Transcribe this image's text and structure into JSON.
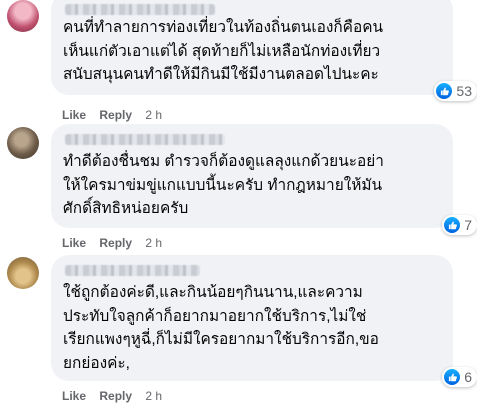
{
  "comments": [
    {
      "text": "คนที่ทำลายการท่องเที่ยวในท้องถิ่นตนเองก็คือคน\nเห็นแก่ตัวเอาแต่ได้ สุดท้ายก็ไม่เหลือนักท่องเที่ยว\nสนับสนุนคนทำดีให้มีกินมีใช้มีงานตลอดไปนะคะ",
      "reaction_count": "53",
      "like_label": "Like",
      "reply_label": "Reply",
      "time": "2 h"
    },
    {
      "text": "ทำดีต้องชื่นชม ตำรวจก็ต้องดูแลลุงแกด้วยนะอย่า\nให้ใครมาข่มขู่แกแบบนี้นะครับ ทำกฎหมายให้มัน\nศักดิ์สิทธิหน่อยครับ",
      "reaction_count": "7",
      "like_label": "Like",
      "reply_label": "Reply",
      "time": "2 h"
    },
    {
      "text": "ใช้ถูกต้องค่ะดี,และกินน้อยๆกินนาน,และความ\nประทับใจลูกค้าก็อยากมาอยากใช้บริการ,ไม่ใช่\nเรียกแพงๆหูฉี่,ก็ไม่มีใครอยากมาใช้บริการอีก,ขอ\nยกย่องค่ะ,",
      "reaction_count": "6",
      "like_label": "Like",
      "reply_label": "Reply",
      "time": "2 h"
    }
  ],
  "colors": {
    "bubble": "#f0f2f5",
    "text": "#050505",
    "secondary": "#65676b",
    "like_blue": "#1877f2"
  },
  "icons": [
    "like-icon"
  ]
}
